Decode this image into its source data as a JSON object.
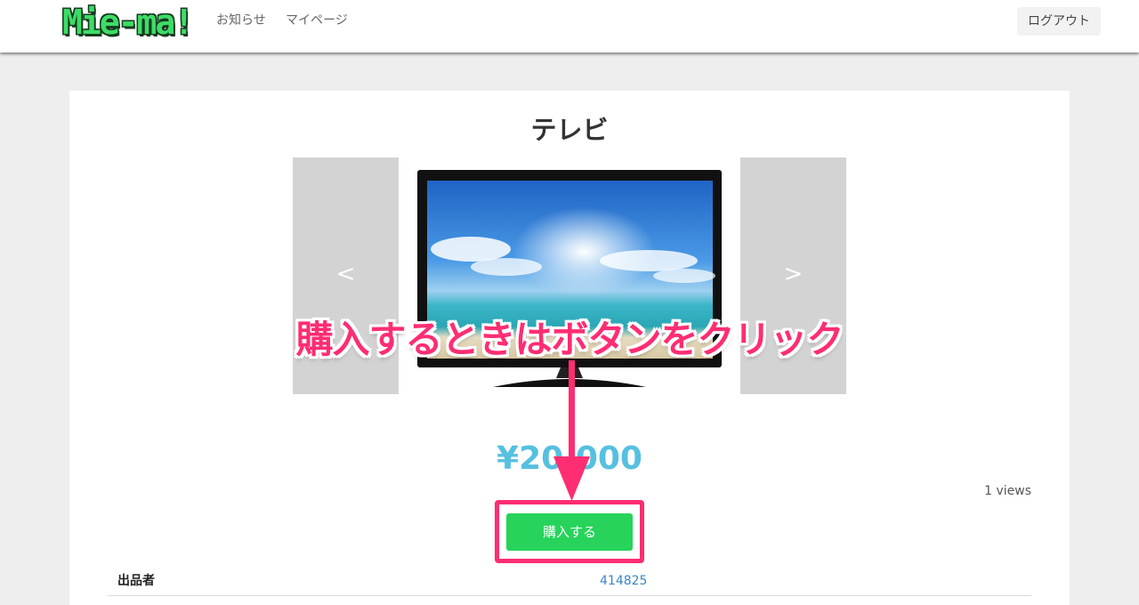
{
  "header": {
    "logo_text": "Mie-ma!",
    "nav": [
      {
        "label": "お知らせ"
      },
      {
        "label": "マイページ"
      }
    ],
    "logout_label": "ログアウト"
  },
  "product": {
    "title": "テレビ",
    "gallery": {
      "prev_arrow": "<",
      "next_arrow": ">",
      "image": "tv-image"
    },
    "price": "¥20,000",
    "views": "1 views",
    "buy_label": "購入する",
    "seller_label": "出品者",
    "seller_value": "414825"
  },
  "annotation": {
    "text": "購入するときはボタンをクリック",
    "color": "#ff2d72"
  },
  "colors": {
    "logo": "#3ddc67",
    "buy_button": "#27d35a",
    "price": "#56c0e0",
    "link": "#3a86c8",
    "annotation": "#ff2d72"
  }
}
